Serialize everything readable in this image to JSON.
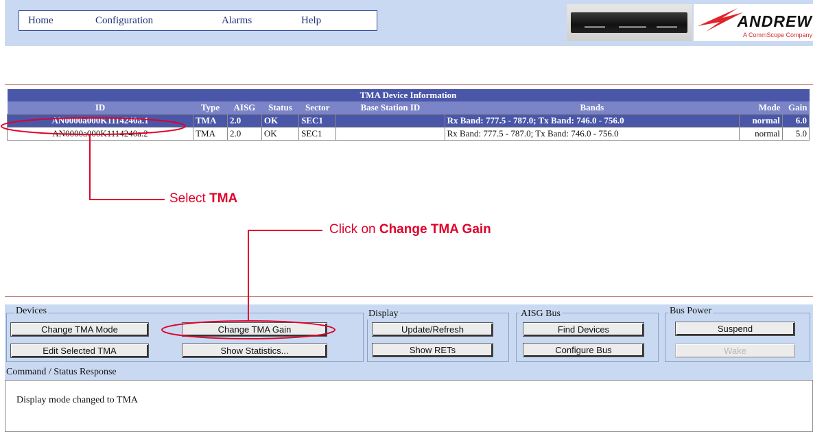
{
  "nav": {
    "items": [
      "Home",
      "Configuration",
      "Alarms",
      "Help"
    ]
  },
  "brand": {
    "logo_text": "ANDREW",
    "tagline": "A CommScope Company"
  },
  "table": {
    "title": "TMA Device Information",
    "columns": [
      "ID",
      "Type",
      "AISG",
      "Status",
      "Sector",
      "Base Station ID",
      "Bands",
      "Mode",
      "Gain"
    ],
    "rows": [
      {
        "id": "AN0000a000K1114240a.1",
        "type": "TMA",
        "aisg": "2.0",
        "status": "OK",
        "sector": "SEC1",
        "bsid": "",
        "bands": "Rx Band: 777.5 - 787.0; Tx Band: 746.0 - 756.0",
        "mode": "normal",
        "gain": "6.0"
      },
      {
        "id": "AN0000a000K1114240a.2",
        "type": "TMA",
        "aisg": "2.0",
        "status": "OK",
        "sector": "SEC1",
        "bsid": "",
        "bands": "Rx Band: 777.5 - 787.0; Tx Band: 746.0 - 756.0",
        "mode": "normal",
        "gain": "5.0"
      }
    ]
  },
  "annotations": {
    "select_prefix": "Select ",
    "select_bold": "TMA",
    "click_prefix": "Click on ",
    "click_bold": "Change TMA Gain"
  },
  "groups": {
    "devices": "Devices",
    "display": "Display",
    "aisg_bus": "AISG Bus",
    "bus_power": "Bus Power"
  },
  "buttons": {
    "change_tma_mode": "Change TMA Mode",
    "change_tma_gain": "Change TMA Gain",
    "edit_selected_tma": "Edit Selected TMA",
    "show_statistics": "Show Statistics...",
    "update_refresh": "Update/Refresh",
    "show_rets": "Show RETs",
    "find_devices": "Find Devices",
    "configure_bus": "Configure Bus",
    "suspend": "Suspend",
    "wake": "Wake"
  },
  "status": {
    "label": "Command / Status Response",
    "message": "Display mode changed to TMA"
  },
  "colors": {
    "header_blue": "#4a56a8",
    "panel_blue": "#c9d9f1",
    "annotation_red": "#e0002a"
  }
}
